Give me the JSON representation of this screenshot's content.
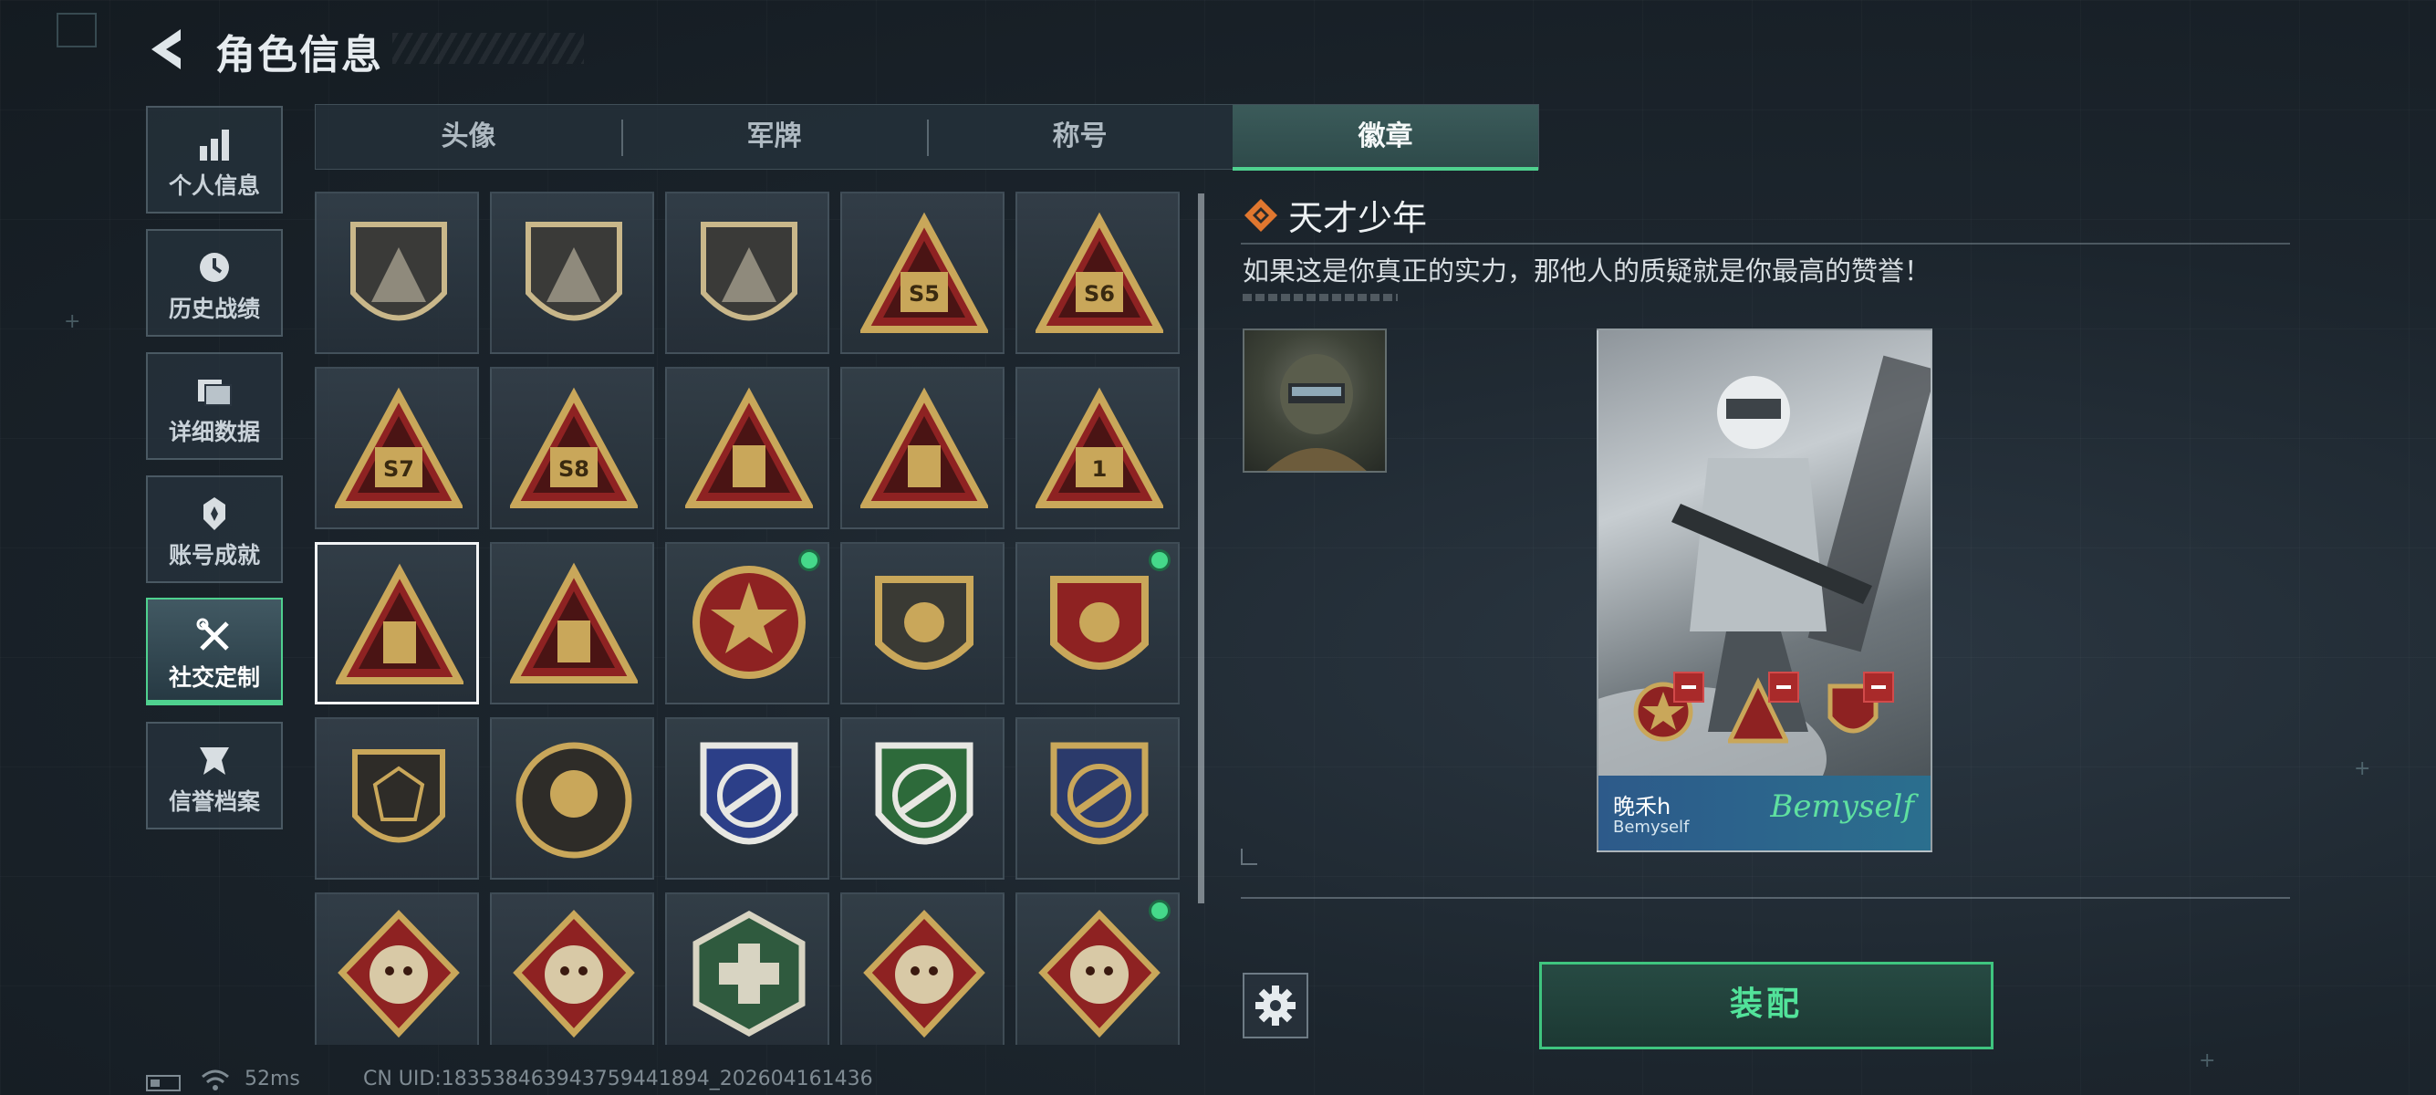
{
  "header": {
    "title": "角色信息"
  },
  "nav": {
    "items": [
      {
        "label": "个人信息",
        "icon": "bar-chart-icon",
        "active": false
      },
      {
        "label": "历史战绩",
        "icon": "history-clock-icon",
        "active": false
      },
      {
        "label": "详细数据",
        "icon": "folder-icon",
        "active": false
      },
      {
        "label": "账号成就",
        "icon": "achievement-medal-icon",
        "active": false
      },
      {
        "label": "社交定制",
        "icon": "wrench-tools-icon",
        "active": true
      },
      {
        "label": "信誉档案",
        "icon": "credit-shield-icon",
        "active": false
      }
    ]
  },
  "tabs": [
    {
      "label": "头像",
      "active": false
    },
    {
      "label": "军牌",
      "active": false
    },
    {
      "label": "称号",
      "active": false
    },
    {
      "label": "徽章",
      "active": true
    }
  ],
  "badges": {
    "rows": [
      [
        {
          "name": "triangle-emblem-badge",
          "shape": "shield",
          "mark": "delta",
          "new": false
        },
        {
          "name": "helicopter-badge",
          "shape": "shield",
          "mark": "heli",
          "new": false
        },
        {
          "name": "dagger-shield-badge",
          "shape": "shield",
          "mark": "dagger",
          "new": false
        },
        {
          "name": "season-s5-badge",
          "shape": "triangle",
          "mark": "S5",
          "new": false
        },
        {
          "name": "season-s6-badge",
          "shape": "triangle",
          "mark": "S6",
          "new": false
        }
      ],
      [
        {
          "name": "season-s7-badge",
          "shape": "triangle",
          "mark": "S7",
          "new": false
        },
        {
          "name": "season-s8-badge",
          "shape": "triangle",
          "mark": "S8",
          "new": false
        },
        {
          "name": "trophy-triangle-badge",
          "shape": "triangle",
          "mark": "trophy",
          "new": false
        },
        {
          "name": "nest-triangle-badge",
          "shape": "triangle",
          "mark": "nest",
          "new": false
        },
        {
          "name": "number-one-badge",
          "shape": "triangle",
          "mark": "1",
          "new": false
        }
      ],
      [
        {
          "name": "usb-triangle-badge",
          "shape": "triangle",
          "mark": "usb",
          "new": false,
          "selected": true
        },
        {
          "name": "squad-triangle-badge",
          "shape": "triangle",
          "mark": "squad",
          "new": false
        },
        {
          "name": "star-roundel-badge",
          "shape": "roundel",
          "mark": "star",
          "new": true
        },
        {
          "name": "dark-crest-badge",
          "shape": "crest",
          "mark": "crest",
          "new": false
        },
        {
          "name": "laurel-crest-badge",
          "shape": "crest-gold",
          "mark": "crest",
          "new": true
        }
      ],
      [
        {
          "name": "dice-shield-badge",
          "shape": "shield-round",
          "mark": "dice",
          "new": false
        },
        {
          "name": "skull-round-badge",
          "shape": "circle",
          "mark": "skull",
          "new": false
        },
        {
          "name": "blue-rifle-badge",
          "shape": "shield-blue",
          "mark": "rifle",
          "new": false
        },
        {
          "name": "green-rifle-badge",
          "shape": "shield-green",
          "mark": "rifle",
          "new": false
        },
        {
          "name": "gold-rifle-badge",
          "shape": "shield-gold",
          "mark": "rifle",
          "new": false
        }
      ],
      [
        {
          "name": "wolf-diamond-badge",
          "shape": "diamond",
          "mark": "wolf",
          "new": false
        },
        {
          "name": "wolf-diamond-badge-2",
          "shape": "diamond",
          "mark": "wolf",
          "new": false
        },
        {
          "name": "medic-hex-badge",
          "shape": "hex",
          "mark": "medic",
          "new": false
        },
        {
          "name": "dragon-diamond-badge",
          "shape": "diamond",
          "mark": "dragon",
          "new": false
        },
        {
          "name": "dragon-diamond-badge-2",
          "shape": "diamond",
          "mark": "dragon",
          "new": true
        }
      ]
    ]
  },
  "detail": {
    "title": "天才少年",
    "description": "如果这是你真正的实力，那他人的质疑就是你最高的赞誉！",
    "card": {
      "name": "晚禾h",
      "subtitle": "Bemyself",
      "signature": "Bemyself"
    }
  },
  "actions": {
    "equip_label": "装配"
  },
  "status": {
    "ping": "52ms",
    "uid": "CN UID:1835384639437594418​94_202604161436"
  },
  "colors": {
    "accent": "#4fd18f",
    "badge_red": "#8e2222",
    "badge_gold": "#c9a75a"
  }
}
